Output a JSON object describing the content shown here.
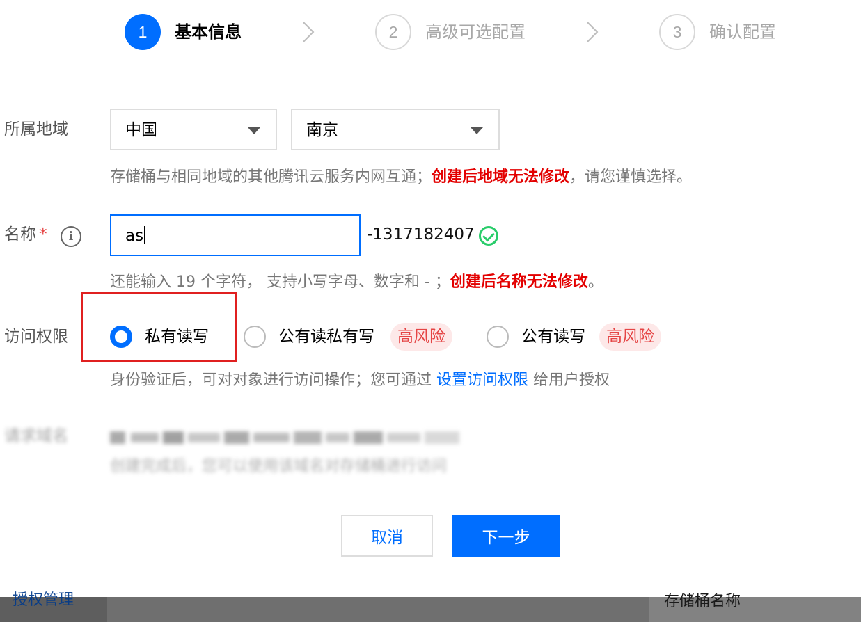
{
  "steps": [
    {
      "number": "1",
      "label": "基本信息",
      "state": "active"
    },
    {
      "number": "2",
      "label": "高级可选配置",
      "state": "inactive"
    },
    {
      "number": "3",
      "label": "确认配置",
      "state": "inactive"
    }
  ],
  "region": {
    "label": "所属地域",
    "country_value": "中国",
    "city_value": "南京",
    "hint_normal": "存储桶与相同地域的其他腾讯云服务内网互通；",
    "hint_warning": "创建后地域无法修改",
    "hint_tail": "，请您谨慎选择。"
  },
  "name": {
    "label": "名称",
    "required_mark": "*",
    "info_icon": "i",
    "value": "as",
    "suffix": "-1317182407",
    "hint_normal": "还能输入 19 个字符， 支持小写字母、数字和 - ；",
    "hint_warning": "创建后名称无法修改",
    "hint_tail": "。"
  },
  "access": {
    "label": "访问权限",
    "options": [
      {
        "label": "私有读写",
        "checked": true,
        "risk": ""
      },
      {
        "label": "公有读私有写",
        "checked": false,
        "risk": "高风险"
      },
      {
        "label": "公有读写",
        "checked": false,
        "risk": "高风险"
      }
    ],
    "hint_normal": "身份验证后，可对对象进行访问操作；您可通过 ",
    "hint_link": "设置访问权限",
    "hint_tail": " 给用户授权"
  },
  "endpoint": {
    "label": "请求域名",
    "hint": "创建完成后，您可以使用该域名对存储桶进行访问"
  },
  "buttons": {
    "cancel": "取消",
    "next": "下一步"
  },
  "background": {
    "left_text": "授权管理",
    "right_text": "存储桶名称"
  },
  "colors": {
    "primary": "#006eff",
    "warning": "#e30000",
    "success": "#29cc6a",
    "risk_bg": "#fde8e8",
    "highlight_border": "#e02020"
  },
  "icons": [
    "chevron-right-icon",
    "caret-down-icon",
    "info-icon",
    "check-circle-icon",
    "radio-icon"
  ]
}
